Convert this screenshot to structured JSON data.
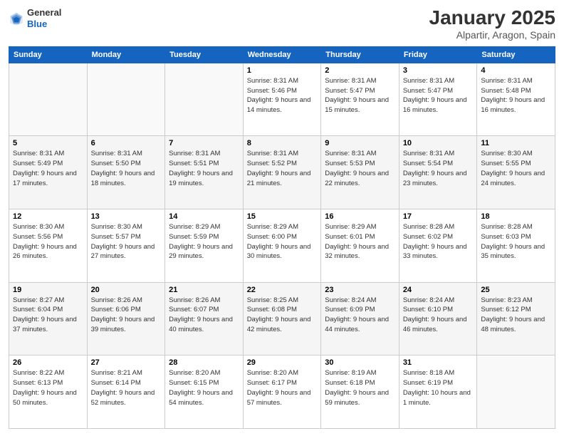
{
  "logo": {
    "general": "General",
    "blue": "Blue"
  },
  "header": {
    "month_year": "January 2025",
    "location": "Alpartir, Aragon, Spain"
  },
  "days_of_week": [
    "Sunday",
    "Monday",
    "Tuesday",
    "Wednesday",
    "Thursday",
    "Friday",
    "Saturday"
  ],
  "weeks": [
    [
      {
        "day": "",
        "sunrise": "",
        "sunset": "",
        "daylight": ""
      },
      {
        "day": "",
        "sunrise": "",
        "sunset": "",
        "daylight": ""
      },
      {
        "day": "",
        "sunrise": "",
        "sunset": "",
        "daylight": ""
      },
      {
        "day": "1",
        "sunrise": "Sunrise: 8:31 AM",
        "sunset": "Sunset: 5:46 PM",
        "daylight": "Daylight: 9 hours and 14 minutes."
      },
      {
        "day": "2",
        "sunrise": "Sunrise: 8:31 AM",
        "sunset": "Sunset: 5:47 PM",
        "daylight": "Daylight: 9 hours and 15 minutes."
      },
      {
        "day": "3",
        "sunrise": "Sunrise: 8:31 AM",
        "sunset": "Sunset: 5:47 PM",
        "daylight": "Daylight: 9 hours and 16 minutes."
      },
      {
        "day": "4",
        "sunrise": "Sunrise: 8:31 AM",
        "sunset": "Sunset: 5:48 PM",
        "daylight": "Daylight: 9 hours and 16 minutes."
      }
    ],
    [
      {
        "day": "5",
        "sunrise": "Sunrise: 8:31 AM",
        "sunset": "Sunset: 5:49 PM",
        "daylight": "Daylight: 9 hours and 17 minutes."
      },
      {
        "day": "6",
        "sunrise": "Sunrise: 8:31 AM",
        "sunset": "Sunset: 5:50 PM",
        "daylight": "Daylight: 9 hours and 18 minutes."
      },
      {
        "day": "7",
        "sunrise": "Sunrise: 8:31 AM",
        "sunset": "Sunset: 5:51 PM",
        "daylight": "Daylight: 9 hours and 19 minutes."
      },
      {
        "day": "8",
        "sunrise": "Sunrise: 8:31 AM",
        "sunset": "Sunset: 5:52 PM",
        "daylight": "Daylight: 9 hours and 21 minutes."
      },
      {
        "day": "9",
        "sunrise": "Sunrise: 8:31 AM",
        "sunset": "Sunset: 5:53 PM",
        "daylight": "Daylight: 9 hours and 22 minutes."
      },
      {
        "day": "10",
        "sunrise": "Sunrise: 8:31 AM",
        "sunset": "Sunset: 5:54 PM",
        "daylight": "Daylight: 9 hours and 23 minutes."
      },
      {
        "day": "11",
        "sunrise": "Sunrise: 8:30 AM",
        "sunset": "Sunset: 5:55 PM",
        "daylight": "Daylight: 9 hours and 24 minutes."
      }
    ],
    [
      {
        "day": "12",
        "sunrise": "Sunrise: 8:30 AM",
        "sunset": "Sunset: 5:56 PM",
        "daylight": "Daylight: 9 hours and 26 minutes."
      },
      {
        "day": "13",
        "sunrise": "Sunrise: 8:30 AM",
        "sunset": "Sunset: 5:57 PM",
        "daylight": "Daylight: 9 hours and 27 minutes."
      },
      {
        "day": "14",
        "sunrise": "Sunrise: 8:29 AM",
        "sunset": "Sunset: 5:59 PM",
        "daylight": "Daylight: 9 hours and 29 minutes."
      },
      {
        "day": "15",
        "sunrise": "Sunrise: 8:29 AM",
        "sunset": "Sunset: 6:00 PM",
        "daylight": "Daylight: 9 hours and 30 minutes."
      },
      {
        "day": "16",
        "sunrise": "Sunrise: 8:29 AM",
        "sunset": "Sunset: 6:01 PM",
        "daylight": "Daylight: 9 hours and 32 minutes."
      },
      {
        "day": "17",
        "sunrise": "Sunrise: 8:28 AM",
        "sunset": "Sunset: 6:02 PM",
        "daylight": "Daylight: 9 hours and 33 minutes."
      },
      {
        "day": "18",
        "sunrise": "Sunrise: 8:28 AM",
        "sunset": "Sunset: 6:03 PM",
        "daylight": "Daylight: 9 hours and 35 minutes."
      }
    ],
    [
      {
        "day": "19",
        "sunrise": "Sunrise: 8:27 AM",
        "sunset": "Sunset: 6:04 PM",
        "daylight": "Daylight: 9 hours and 37 minutes."
      },
      {
        "day": "20",
        "sunrise": "Sunrise: 8:26 AM",
        "sunset": "Sunset: 6:06 PM",
        "daylight": "Daylight: 9 hours and 39 minutes."
      },
      {
        "day": "21",
        "sunrise": "Sunrise: 8:26 AM",
        "sunset": "Sunset: 6:07 PM",
        "daylight": "Daylight: 9 hours and 40 minutes."
      },
      {
        "day": "22",
        "sunrise": "Sunrise: 8:25 AM",
        "sunset": "Sunset: 6:08 PM",
        "daylight": "Daylight: 9 hours and 42 minutes."
      },
      {
        "day": "23",
        "sunrise": "Sunrise: 8:24 AM",
        "sunset": "Sunset: 6:09 PM",
        "daylight": "Daylight: 9 hours and 44 minutes."
      },
      {
        "day": "24",
        "sunrise": "Sunrise: 8:24 AM",
        "sunset": "Sunset: 6:10 PM",
        "daylight": "Daylight: 9 hours and 46 minutes."
      },
      {
        "day": "25",
        "sunrise": "Sunrise: 8:23 AM",
        "sunset": "Sunset: 6:12 PM",
        "daylight": "Daylight: 9 hours and 48 minutes."
      }
    ],
    [
      {
        "day": "26",
        "sunrise": "Sunrise: 8:22 AM",
        "sunset": "Sunset: 6:13 PM",
        "daylight": "Daylight: 9 hours and 50 minutes."
      },
      {
        "day": "27",
        "sunrise": "Sunrise: 8:21 AM",
        "sunset": "Sunset: 6:14 PM",
        "daylight": "Daylight: 9 hours and 52 minutes."
      },
      {
        "day": "28",
        "sunrise": "Sunrise: 8:20 AM",
        "sunset": "Sunset: 6:15 PM",
        "daylight": "Daylight: 9 hours and 54 minutes."
      },
      {
        "day": "29",
        "sunrise": "Sunrise: 8:20 AM",
        "sunset": "Sunset: 6:17 PM",
        "daylight": "Daylight: 9 hours and 57 minutes."
      },
      {
        "day": "30",
        "sunrise": "Sunrise: 8:19 AM",
        "sunset": "Sunset: 6:18 PM",
        "daylight": "Daylight: 9 hours and 59 minutes."
      },
      {
        "day": "31",
        "sunrise": "Sunrise: 8:18 AM",
        "sunset": "Sunset: 6:19 PM",
        "daylight": "Daylight: 10 hours and 1 minute."
      },
      {
        "day": "",
        "sunrise": "",
        "sunset": "",
        "daylight": ""
      }
    ]
  ]
}
